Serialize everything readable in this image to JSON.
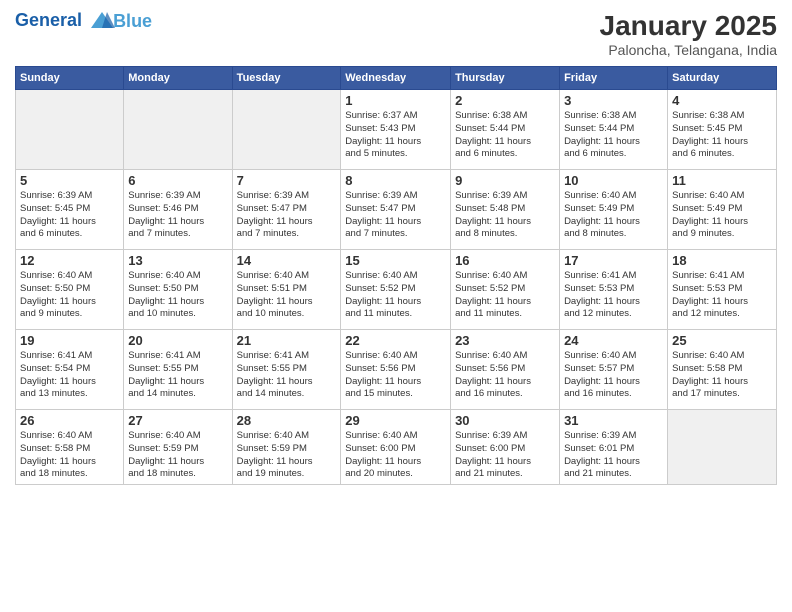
{
  "header": {
    "logo_line1": "General",
    "logo_line2": "Blue",
    "month": "January 2025",
    "location": "Paloncha, Telangana, India"
  },
  "weekdays": [
    "Sunday",
    "Monday",
    "Tuesday",
    "Wednesday",
    "Thursday",
    "Friday",
    "Saturday"
  ],
  "weeks": [
    [
      {
        "day": "",
        "info": ""
      },
      {
        "day": "",
        "info": ""
      },
      {
        "day": "",
        "info": ""
      },
      {
        "day": "1",
        "info": "Sunrise: 6:37 AM\nSunset: 5:43 PM\nDaylight: 11 hours\nand 5 minutes."
      },
      {
        "day": "2",
        "info": "Sunrise: 6:38 AM\nSunset: 5:44 PM\nDaylight: 11 hours\nand 6 minutes."
      },
      {
        "day": "3",
        "info": "Sunrise: 6:38 AM\nSunset: 5:44 PM\nDaylight: 11 hours\nand 6 minutes."
      },
      {
        "day": "4",
        "info": "Sunrise: 6:38 AM\nSunset: 5:45 PM\nDaylight: 11 hours\nand 6 minutes."
      }
    ],
    [
      {
        "day": "5",
        "info": "Sunrise: 6:39 AM\nSunset: 5:45 PM\nDaylight: 11 hours\nand 6 minutes."
      },
      {
        "day": "6",
        "info": "Sunrise: 6:39 AM\nSunset: 5:46 PM\nDaylight: 11 hours\nand 7 minutes."
      },
      {
        "day": "7",
        "info": "Sunrise: 6:39 AM\nSunset: 5:47 PM\nDaylight: 11 hours\nand 7 minutes."
      },
      {
        "day": "8",
        "info": "Sunrise: 6:39 AM\nSunset: 5:47 PM\nDaylight: 11 hours\nand 7 minutes."
      },
      {
        "day": "9",
        "info": "Sunrise: 6:39 AM\nSunset: 5:48 PM\nDaylight: 11 hours\nand 8 minutes."
      },
      {
        "day": "10",
        "info": "Sunrise: 6:40 AM\nSunset: 5:49 PM\nDaylight: 11 hours\nand 8 minutes."
      },
      {
        "day": "11",
        "info": "Sunrise: 6:40 AM\nSunset: 5:49 PM\nDaylight: 11 hours\nand 9 minutes."
      }
    ],
    [
      {
        "day": "12",
        "info": "Sunrise: 6:40 AM\nSunset: 5:50 PM\nDaylight: 11 hours\nand 9 minutes."
      },
      {
        "day": "13",
        "info": "Sunrise: 6:40 AM\nSunset: 5:50 PM\nDaylight: 11 hours\nand 10 minutes."
      },
      {
        "day": "14",
        "info": "Sunrise: 6:40 AM\nSunset: 5:51 PM\nDaylight: 11 hours\nand 10 minutes."
      },
      {
        "day": "15",
        "info": "Sunrise: 6:40 AM\nSunset: 5:52 PM\nDaylight: 11 hours\nand 11 minutes."
      },
      {
        "day": "16",
        "info": "Sunrise: 6:40 AM\nSunset: 5:52 PM\nDaylight: 11 hours\nand 11 minutes."
      },
      {
        "day": "17",
        "info": "Sunrise: 6:41 AM\nSunset: 5:53 PM\nDaylight: 11 hours\nand 12 minutes."
      },
      {
        "day": "18",
        "info": "Sunrise: 6:41 AM\nSunset: 5:53 PM\nDaylight: 11 hours\nand 12 minutes."
      }
    ],
    [
      {
        "day": "19",
        "info": "Sunrise: 6:41 AM\nSunset: 5:54 PM\nDaylight: 11 hours\nand 13 minutes."
      },
      {
        "day": "20",
        "info": "Sunrise: 6:41 AM\nSunset: 5:55 PM\nDaylight: 11 hours\nand 14 minutes."
      },
      {
        "day": "21",
        "info": "Sunrise: 6:41 AM\nSunset: 5:55 PM\nDaylight: 11 hours\nand 14 minutes."
      },
      {
        "day": "22",
        "info": "Sunrise: 6:40 AM\nSunset: 5:56 PM\nDaylight: 11 hours\nand 15 minutes."
      },
      {
        "day": "23",
        "info": "Sunrise: 6:40 AM\nSunset: 5:56 PM\nDaylight: 11 hours\nand 16 minutes."
      },
      {
        "day": "24",
        "info": "Sunrise: 6:40 AM\nSunset: 5:57 PM\nDaylight: 11 hours\nand 16 minutes."
      },
      {
        "day": "25",
        "info": "Sunrise: 6:40 AM\nSunset: 5:58 PM\nDaylight: 11 hours\nand 17 minutes."
      }
    ],
    [
      {
        "day": "26",
        "info": "Sunrise: 6:40 AM\nSunset: 5:58 PM\nDaylight: 11 hours\nand 18 minutes."
      },
      {
        "day": "27",
        "info": "Sunrise: 6:40 AM\nSunset: 5:59 PM\nDaylight: 11 hours\nand 18 minutes."
      },
      {
        "day": "28",
        "info": "Sunrise: 6:40 AM\nSunset: 5:59 PM\nDaylight: 11 hours\nand 19 minutes."
      },
      {
        "day": "29",
        "info": "Sunrise: 6:40 AM\nSunset: 6:00 PM\nDaylight: 11 hours\nand 20 minutes."
      },
      {
        "day": "30",
        "info": "Sunrise: 6:39 AM\nSunset: 6:00 PM\nDaylight: 11 hours\nand 21 minutes."
      },
      {
        "day": "31",
        "info": "Sunrise: 6:39 AM\nSunset: 6:01 PM\nDaylight: 11 hours\nand 21 minutes."
      },
      {
        "day": "",
        "info": ""
      }
    ]
  ]
}
